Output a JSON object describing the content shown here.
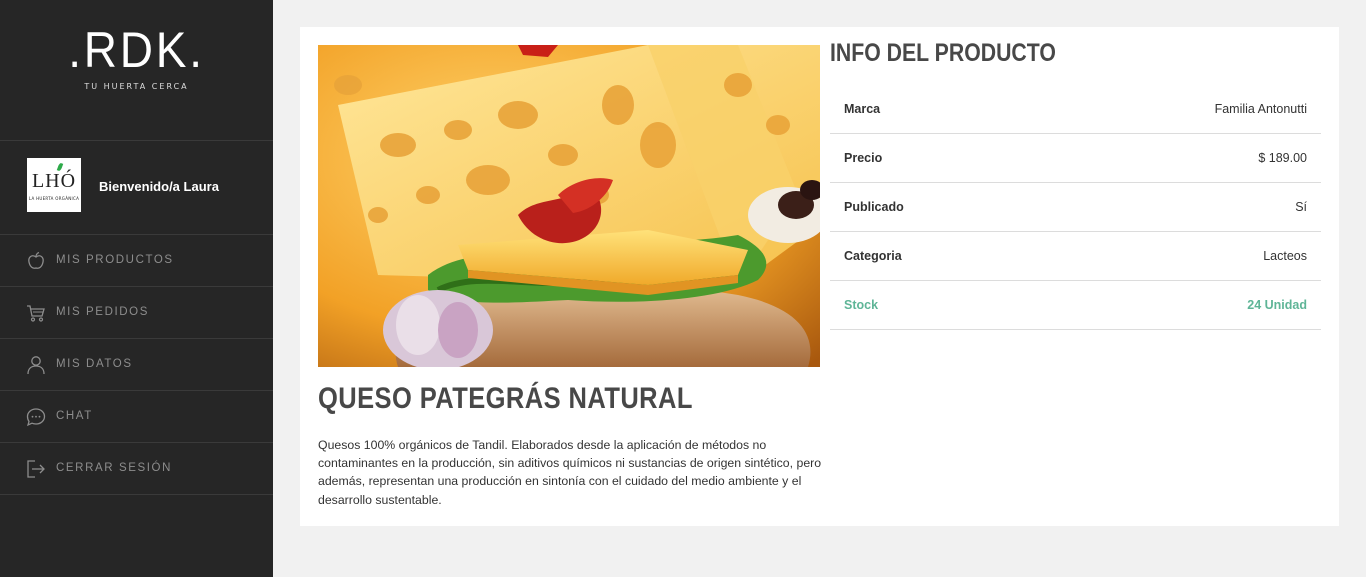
{
  "brand": {
    "logo": ".RDK.",
    "tagline": "TU HUERTA CERCA"
  },
  "user": {
    "avatar_text": "LHÓ",
    "avatar_sub": "LA HUERTA ORGÁNICA",
    "greeting": "Bienvenido/a Laura"
  },
  "nav": {
    "items": [
      {
        "label": "MIS PRODUCTOS",
        "icon": "apple-icon"
      },
      {
        "label": "MIS PEDIDOS",
        "icon": "cart-icon"
      },
      {
        "label": "MIS DATOS",
        "icon": "user-icon"
      },
      {
        "label": "CHAT",
        "icon": "chat-icon"
      },
      {
        "label": "CERRAR SESIÓN",
        "icon": "logout-icon"
      }
    ]
  },
  "product": {
    "title": "QUESO PATEGRÁS NATURAL",
    "description": "Quesos 100% orgánicos de Tandil. Elaborados desde la aplicación de métodos no contaminantes en la producción, sin aditivos químicos ni sustancias de origen sintético, pero además, representan una producción en sintonía con el cuidado del medio ambiente y el desarrollo sustentable."
  },
  "info": {
    "title": "INFO DEL PRODUCTO",
    "rows": [
      {
        "key": "Marca",
        "value": "Familia Antonutti"
      },
      {
        "key": "Precio",
        "value": "$ 189.00"
      },
      {
        "key": "Publicado",
        "value": "Sí"
      },
      {
        "key": "Categoria",
        "value": "Lacteos"
      },
      {
        "key": "Stock",
        "value": "24 Unidad"
      }
    ]
  },
  "colors": {
    "sidebar": "#262626",
    "accent": "#5fb597",
    "background": "#f1f1f1"
  }
}
